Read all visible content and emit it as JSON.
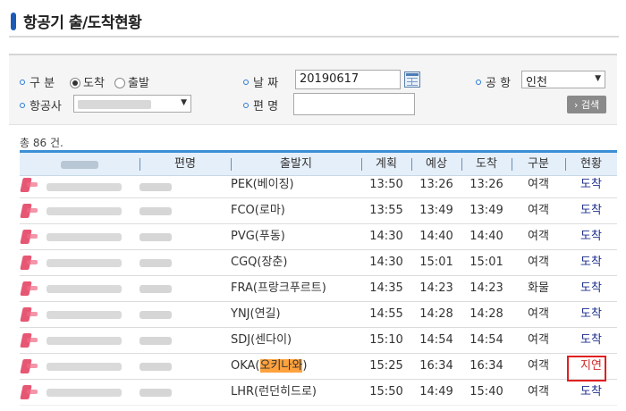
{
  "header": {
    "title": "항공기 출/도착현황"
  },
  "search": {
    "division_label": "구  분",
    "radio_arrival": "도착",
    "radio_departure": "출발",
    "date_label": "날  짜",
    "date_value": "20190617",
    "airport_label": "공  항",
    "airport_value": "인천",
    "airline_label": "항공사",
    "flight_label": "편  명",
    "flight_value": "",
    "search_button": "› 검색"
  },
  "summary": {
    "count_text": "총 86 건."
  },
  "table": {
    "columns": [
      "항공사",
      "편명",
      "출발지",
      "계획",
      "예상",
      "도착",
      "구분",
      "현황"
    ],
    "rows": [
      {
        "origin": "PEK(베이징)",
        "planned": "13:50",
        "expected": "13:26",
        "arrival": "13:26",
        "type": "여객",
        "status": "도착"
      },
      {
        "origin": "FCO(로마)",
        "planned": "13:55",
        "expected": "13:49",
        "arrival": "13:49",
        "type": "여객",
        "status": "도착"
      },
      {
        "origin": "PVG(푸동)",
        "planned": "14:30",
        "expected": "14:40",
        "arrival": "14:40",
        "type": "여객",
        "status": "도착"
      },
      {
        "origin": "CGQ(장춘)",
        "planned": "14:30",
        "expected": "15:01",
        "arrival": "15:01",
        "type": "여객",
        "status": "도착"
      },
      {
        "origin": "FRA(프랑크푸르트)",
        "planned": "14:35",
        "expected": "14:23",
        "arrival": "14:23",
        "type": "화물",
        "status": "도착"
      },
      {
        "origin": "YNJ(연길)",
        "planned": "14:55",
        "expected": "14:28",
        "arrival": "14:28",
        "type": "여객",
        "status": "도착"
      },
      {
        "origin": "SDJ(센다이)",
        "planned": "15:10",
        "expected": "14:54",
        "arrival": "14:54",
        "type": "여객",
        "status": "도착"
      },
      {
        "origin_code": "OKA(",
        "origin_name": "오키나와",
        "origin_close": ")",
        "planned": "15:25",
        "expected": "16:34",
        "arrival": "16:34",
        "type": "여객",
        "status": "지연"
      },
      {
        "origin": "LHR(런던히드로)",
        "planned": "15:50",
        "expected": "14:49",
        "arrival": "15:40",
        "type": "여객",
        "status": "도착"
      }
    ]
  },
  "colors": {
    "accent": "#3a8fd6",
    "status_normal": "#1c2f8c",
    "status_delay": "#d12a2a",
    "highlight": "#ffa23d"
  }
}
